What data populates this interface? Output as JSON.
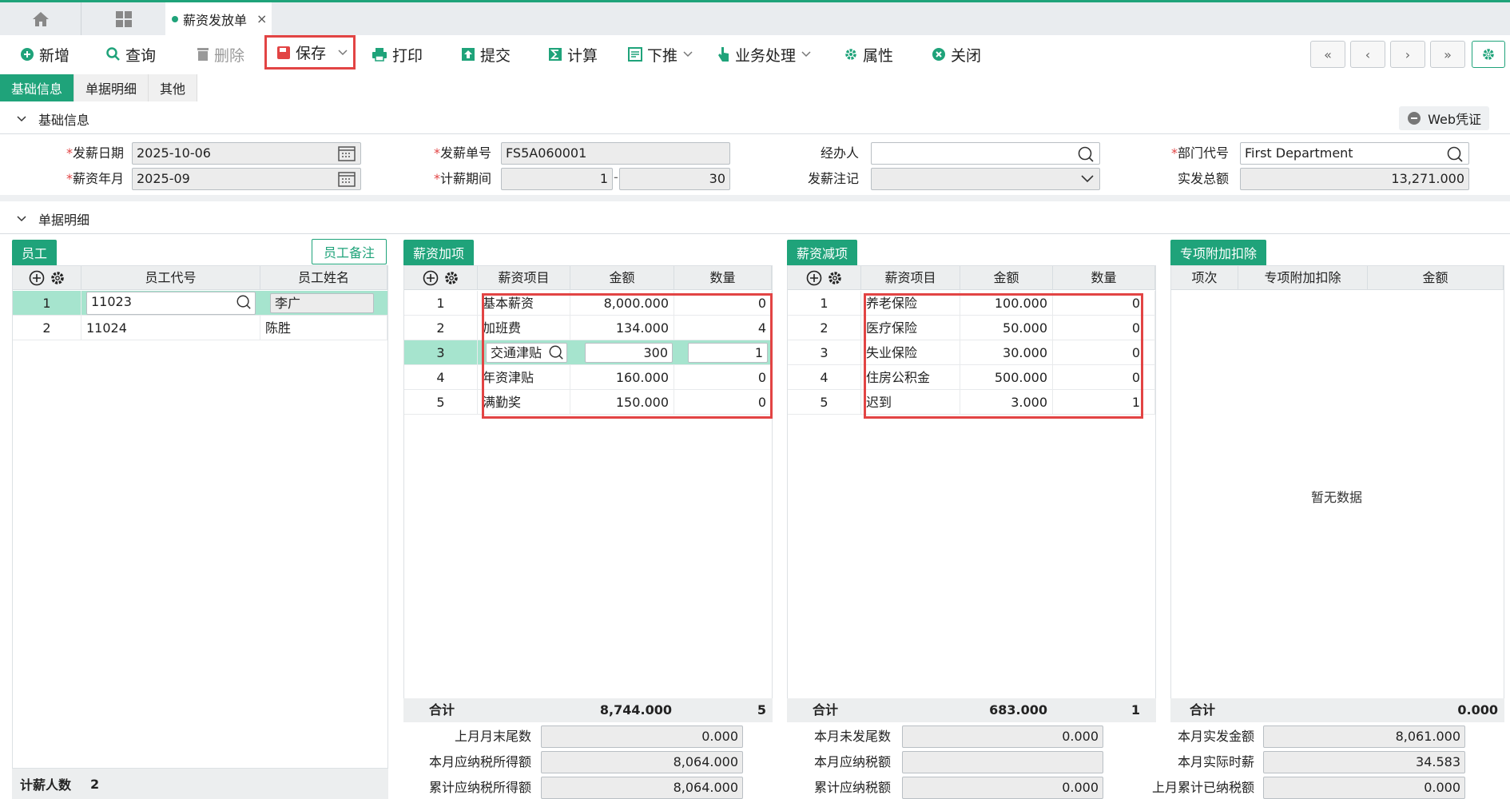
{
  "tabs_bar": {
    "doc_tab_label": "薪资发放单",
    "close_glyph": "×"
  },
  "toolbar": {
    "add": "新增",
    "query": "查询",
    "delete": "删除",
    "save": "保存",
    "print": "打印",
    "submit": "提交",
    "calculate": "计算",
    "push_down": "下推",
    "business": "业务处理",
    "properties": "属性",
    "close": "关闭"
  },
  "form_tabs": [
    "基础信息",
    "单据明细",
    "其他"
  ],
  "sections": {
    "basic": "基础信息",
    "detail": "单据明细",
    "web_voucher": "Web凭证"
  },
  "basic_info": {
    "pay_date_label": "发薪日期",
    "pay_date": "2025-10-06",
    "pay_month_label": "薪资年月",
    "pay_month": "2025-09",
    "doc_no_label": "发薪单号",
    "doc_no": "FS5A060001",
    "period_label": "计薪期间",
    "period_from": "1",
    "period_sep": "-",
    "period_to": "30",
    "handler_label": "经办人",
    "handler": "",
    "remark_label": "发薪注记",
    "remark": "",
    "dept_label": "部门代号",
    "dept": "First Department",
    "total_label": "实发总额",
    "total": "13,271.000"
  },
  "employees": {
    "tab": "员工",
    "note_button": "员工备注",
    "headers": [
      "员工代号",
      "员工姓名"
    ],
    "rows": [
      {
        "no": "1",
        "code": "11023",
        "name": "李广"
      },
      {
        "no": "2",
        "code": "11024",
        "name": "陈胜"
      }
    ],
    "footer_label": "计薪人数",
    "footer_value": "2"
  },
  "additions": {
    "tab": "薪资加项",
    "headers": [
      "薪资项目",
      "金额",
      "数量"
    ],
    "rows": [
      {
        "no": "1",
        "item": "基本薪资",
        "amount": "8,000.000",
        "qty": "0"
      },
      {
        "no": "2",
        "item": "加班费",
        "amount": "134.000",
        "qty": "4"
      },
      {
        "no": "3",
        "item": "交通津贴",
        "amount": "300",
        "qty": "1"
      },
      {
        "no": "4",
        "item": "年资津贴",
        "amount": "160.000",
        "qty": "0"
      },
      {
        "no": "5",
        "item": "满勤奖",
        "amount": "150.000",
        "qty": "0"
      }
    ],
    "total_label": "合计",
    "total_amount": "8,744.000",
    "total_qty": "5",
    "summary": [
      {
        "label": "上月月末尾数",
        "value": "0.000"
      },
      {
        "label": "本月应纳税所得额",
        "value": "8,064.000"
      },
      {
        "label": "累计应纳税所得额",
        "value": "8,064.000"
      }
    ]
  },
  "deductions": {
    "tab": "薪资减项",
    "headers": [
      "薪资项目",
      "金额",
      "数量"
    ],
    "rows": [
      {
        "no": "1",
        "item": "养老保险",
        "amount": "100.000",
        "qty": "0"
      },
      {
        "no": "2",
        "item": "医疗保险",
        "amount": "50.000",
        "qty": "0"
      },
      {
        "no": "3",
        "item": "失业保险",
        "amount": "30.000",
        "qty": "0"
      },
      {
        "no": "4",
        "item": "住房公积金",
        "amount": "500.000",
        "qty": "0"
      },
      {
        "no": "5",
        "item": "迟到",
        "amount": "3.000",
        "qty": "1"
      }
    ],
    "total_label": "合计",
    "total_amount": "683.000",
    "total_qty": "1",
    "summary": [
      {
        "label": "本月未发尾数",
        "value": "0.000"
      },
      {
        "label": "本月应纳税额",
        "value": ""
      },
      {
        "label": "累计应纳税额",
        "value": "0.000"
      }
    ]
  },
  "special": {
    "tab": "专项附加扣除",
    "headers": [
      "项次",
      "专项附加扣除",
      "金额"
    ],
    "empty": "暂无数据",
    "total_label": "合计",
    "total_amount": "0.000",
    "summary": [
      {
        "label": "本月实发金额",
        "value": "8,061.000"
      },
      {
        "label": "本月实际时薪",
        "value": "34.583"
      },
      {
        "label": "上月累计已纳税额",
        "value": "0.000"
      }
    ]
  },
  "colors": {
    "accent": "#1fa37a",
    "highlight": "#e24444",
    "selected_row": "#a6e4ce"
  }
}
